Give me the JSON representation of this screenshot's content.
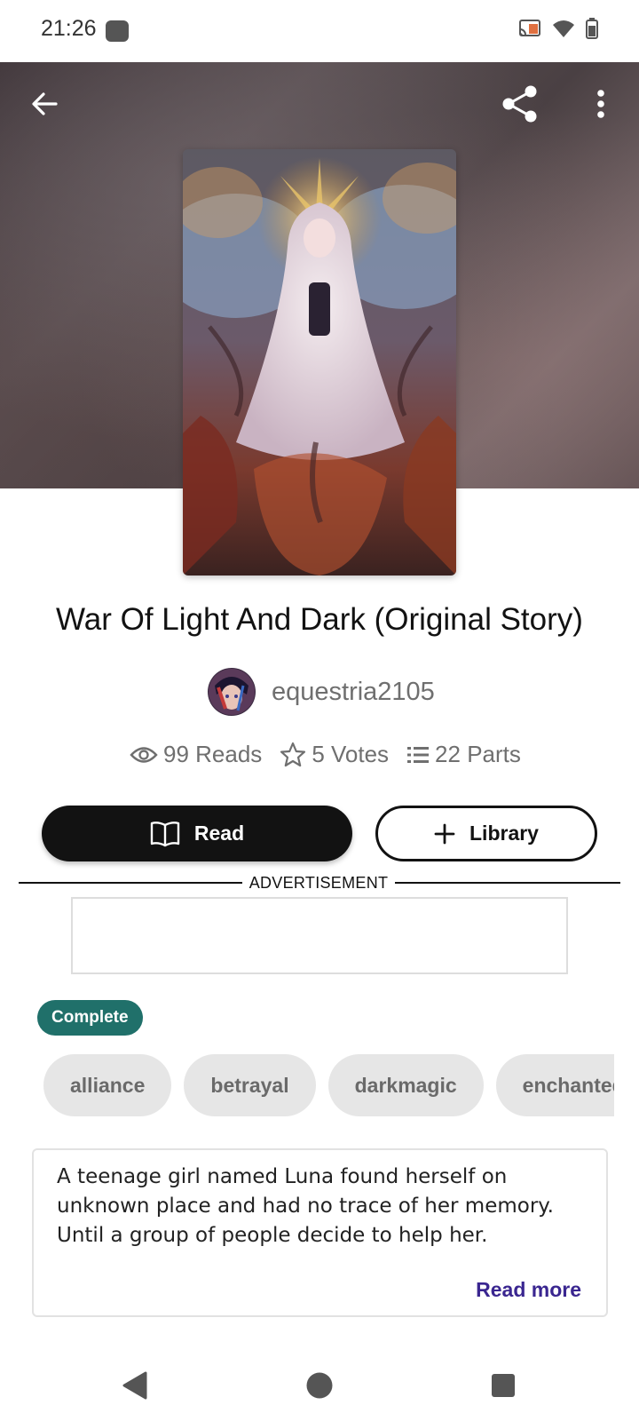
{
  "status_bar": {
    "time": "21:26"
  },
  "header": {
    "back_icon": "arrow-left-icon",
    "share_icon": "share-icon",
    "more_icon": "more-vertical-icon"
  },
  "story": {
    "title": "War Of Light And Dark (Original Story)",
    "author": "equestria2105",
    "stats": {
      "reads": "99 Reads",
      "votes": "5 Votes",
      "parts": "22 Parts"
    },
    "status_badge": "Complete",
    "tags": [
      "alliance",
      "betrayal",
      "darkmagic",
      "enchantedfo"
    ],
    "description": "A teenage girl named Luna found herself on unknown place and had no trace of her memory. Until a group of people decide to help her.",
    "read_more": "Read more"
  },
  "actions": {
    "read_label": "Read",
    "library_label": "Library"
  },
  "ad": {
    "label": "ADVERTISEMENT"
  },
  "colors": {
    "primary": "#121212",
    "complete_badge": "#20706a",
    "read_more": "#3a2690",
    "tag_bg": "#e6e6e6"
  }
}
